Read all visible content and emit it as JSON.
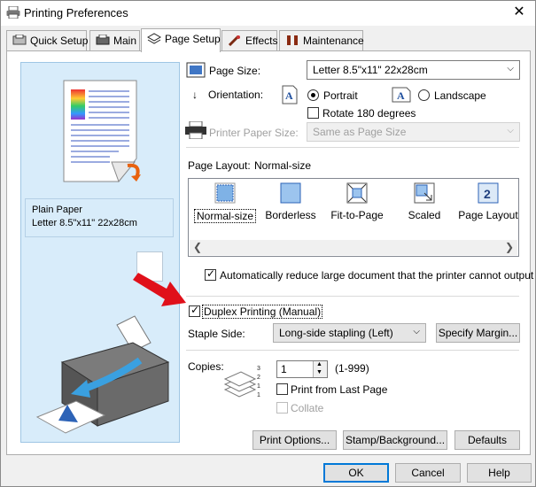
{
  "window": {
    "title": "Printing Preferences",
    "close_glyph": "✕"
  },
  "tabs": [
    {
      "label": "Quick Setup",
      "icon": "quick-setup-icon"
    },
    {
      "label": "Main",
      "icon": "main-icon"
    },
    {
      "label": "Page Setup",
      "icon": "page-setup-icon"
    },
    {
      "label": "Effects",
      "icon": "effects-icon"
    },
    {
      "label": "Maintenance",
      "icon": "maintenance-icon"
    }
  ],
  "preview": {
    "media": "Plain Paper",
    "size": "Letter 8.5\"x11\" 22x28cm"
  },
  "page_size": {
    "label": "Page Size:",
    "value": "Letter 8.5\"x11\" 22x28cm"
  },
  "orientation": {
    "label": "Orientation:",
    "portrait": "Portrait",
    "landscape": "Landscape",
    "selected": "Portrait"
  },
  "rotate": {
    "label": "Rotate 180 degrees",
    "checked": false
  },
  "printer_paper_size": {
    "label": "Printer Paper Size:",
    "value": "Same as Page Size"
  },
  "page_layout": {
    "label": "Page Layout:",
    "current": "Normal-size",
    "items": [
      "Normal-size",
      "Borderless",
      "Fit-to-Page",
      "Scaled",
      "Page Layout"
    ]
  },
  "auto_reduce": {
    "label": "Automatically reduce large document that the printer cannot output",
    "checked": true
  },
  "duplex": {
    "label": "Duplex Printing (Manual)",
    "checked": true
  },
  "staple": {
    "label": "Staple Side:",
    "value": "Long-side stapling (Left)",
    "button": "Specify Margin..."
  },
  "copies": {
    "label": "Copies:",
    "value": "1",
    "range": "(1-999)"
  },
  "print_from_last": {
    "label": "Print from Last Page",
    "checked": false
  },
  "collate": {
    "label": "Collate",
    "checked": false
  },
  "buttons": {
    "print_options": "Print Options...",
    "stamp_background": "Stamp/Background...",
    "defaults": "Defaults"
  },
  "footer": {
    "ok": "OK",
    "cancel": "Cancel",
    "help": "Help"
  },
  "colors": {
    "accent": "#0078d7",
    "preview_bg": "#d8ecfa",
    "arrow_red": "#e0101a"
  }
}
